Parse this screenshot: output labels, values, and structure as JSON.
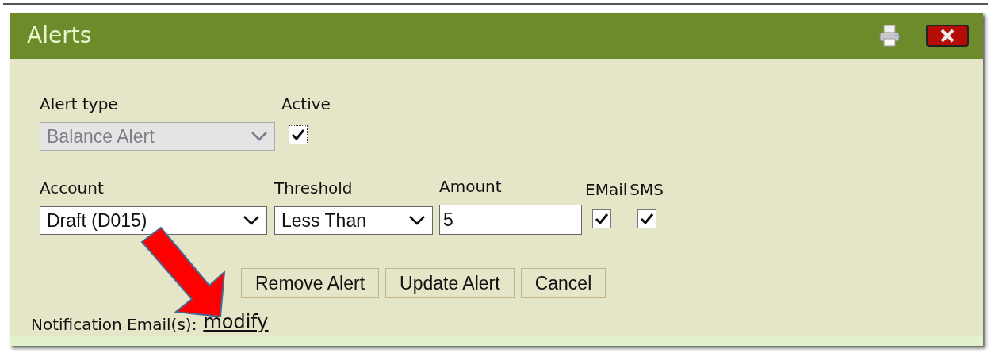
{
  "dialog": {
    "title": "Alerts"
  },
  "alert_type": {
    "label": "Alert type",
    "value": "Balance Alert",
    "disabled": true
  },
  "active": {
    "label": "Active",
    "checked": true
  },
  "account": {
    "label": "Account",
    "value": "Draft (D015)"
  },
  "threshold": {
    "label": "Threshold",
    "value": "Less Than"
  },
  "amount": {
    "label": "Amount",
    "value": "5"
  },
  "email": {
    "label": "EMail",
    "checked": true
  },
  "sms": {
    "label": "SMS",
    "checked": true
  },
  "buttons": [
    "Remove Alert",
    "Update Alert",
    "Cancel"
  ],
  "notification": {
    "label": "Notification Email(s):",
    "link": "modify"
  }
}
